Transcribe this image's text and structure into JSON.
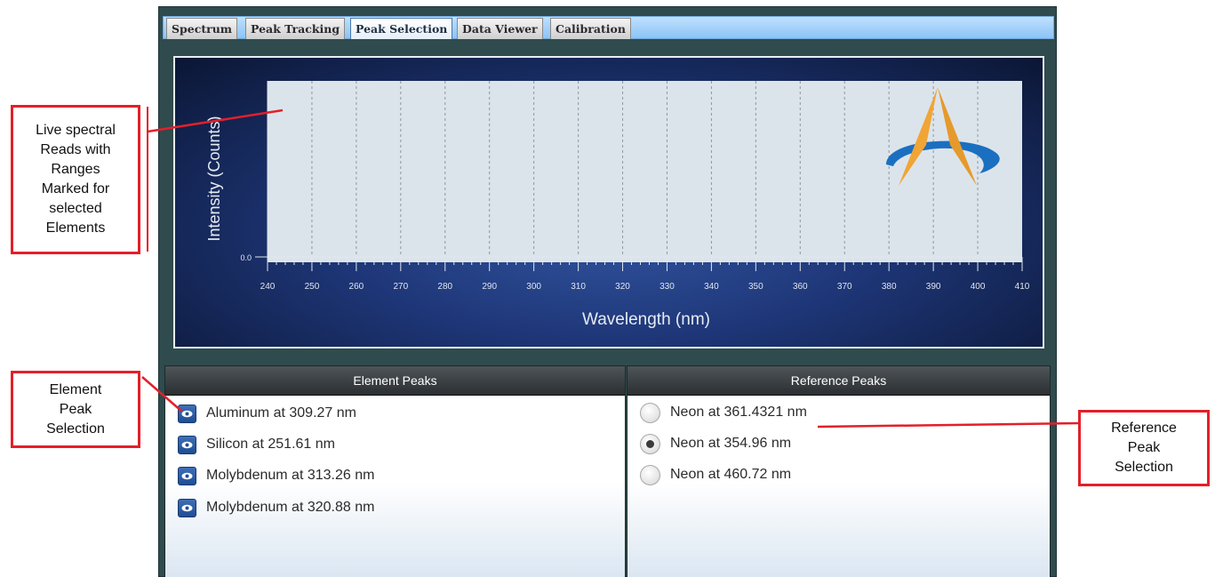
{
  "tabs": [
    {
      "label": "Spectrum",
      "active": false
    },
    {
      "label": "Peak Tracking",
      "active": false
    },
    {
      "label": "Peak Selection",
      "active": true
    },
    {
      "label": "Data Viewer",
      "active": false
    },
    {
      "label": "Calibration",
      "active": false
    }
  ],
  "chart": {
    "xlabel": "Wavelength (nm)",
    "ylabel": "Intensity (Counts)",
    "y_tick": "0.0",
    "x_ticks": [
      "240",
      "250",
      "260",
      "270",
      "280",
      "290",
      "300",
      "310",
      "320",
      "330",
      "340",
      "350",
      "360",
      "370",
      "380",
      "390",
      "400",
      "410"
    ],
    "logo_icon": "a-logo-icon",
    "colors": {
      "plot_bg": "#dce4eb",
      "panel_bg": "#1e3677",
      "logo_orange": "#f0a535",
      "logo_blue": "#1b6fc0"
    }
  },
  "element_peaks": {
    "header": "Element Peaks",
    "items": [
      {
        "label": "Aluminum at 309.27 nm"
      },
      {
        "label": "Silicon at 251.61 nm"
      },
      {
        "label": "Molybdenum at 313.26 nm"
      },
      {
        "label": "Molybdenum at 320.88 nm"
      }
    ]
  },
  "reference_peaks": {
    "header": "Reference Peaks",
    "items": [
      {
        "label": "Neon at 361.4321 nm",
        "selected": false
      },
      {
        "label": "Neon at 354.96 nm",
        "selected": true
      },
      {
        "label": "Neon at 460.72 nm",
        "selected": false
      }
    ]
  },
  "callouts": {
    "live_spectral": [
      "Live spectral",
      "Reads with",
      "Ranges",
      "Marked for",
      "selected",
      "Elements"
    ],
    "element_peak": [
      "Element",
      "Peak",
      "Selection"
    ],
    "reference_peak": [
      "Reference",
      "Peak",
      "Selection"
    ]
  },
  "accent_color": "#e2202a"
}
